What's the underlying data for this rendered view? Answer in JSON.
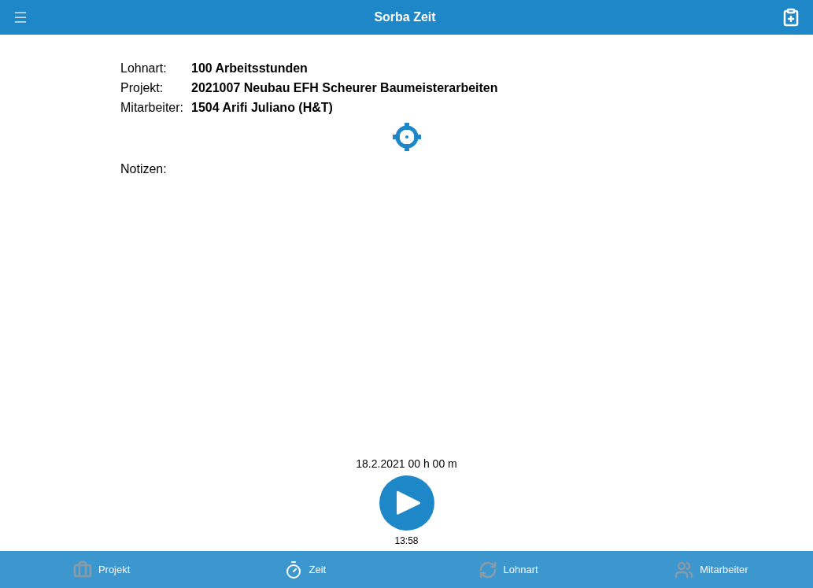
{
  "header": {
    "title": "Sorba Zeit"
  },
  "fields": [
    {
      "label": "Lohnart:",
      "value": "100 Arbeitsstunden"
    },
    {
      "label": "Projekt:",
      "value": "2021007 Neubau EFH Scheurer Baumeisterarbeiten"
    },
    {
      "label": "Mitarbeiter:",
      "value": "1504 Arifi Juliano (H&T)"
    }
  ],
  "notes": {
    "label": "Notizen:"
  },
  "timer": {
    "summary": "18.2.2021 00 h 00 m",
    "time": "13:58"
  },
  "tabs": [
    {
      "kind": "project",
      "label": "Projekt",
      "selected": false
    },
    {
      "kind": "time",
      "label": "Zeit",
      "selected": true
    },
    {
      "kind": "wage",
      "label": "Lohnart",
      "selected": false
    },
    {
      "kind": "staff",
      "label": "Mitarbeiter",
      "selected": false
    }
  ]
}
